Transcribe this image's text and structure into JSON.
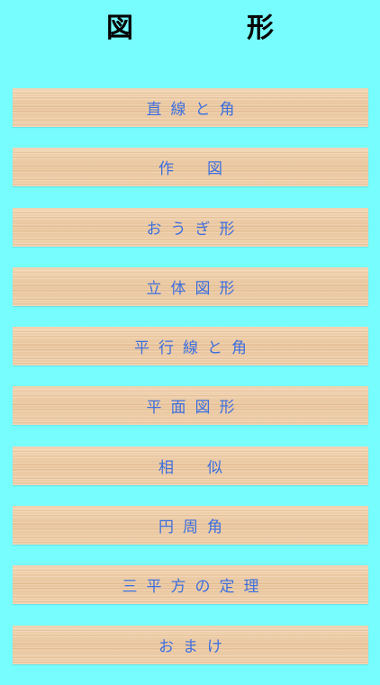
{
  "header": {
    "title": "図　形"
  },
  "menu": {
    "items": [
      {
        "label": "直線と角"
      },
      {
        "label": "作　図"
      },
      {
        "label": "おうぎ形"
      },
      {
        "label": "立体図形"
      },
      {
        "label": "平行線と角"
      },
      {
        "label": "平面図形"
      },
      {
        "label": "相　似"
      },
      {
        "label": "円周角"
      },
      {
        "label": "三平方の定理"
      },
      {
        "label": "おまけ"
      }
    ]
  },
  "colors": {
    "background": "#78fdfe",
    "button_wood": "#edcba5",
    "label_text": "#3f6fdc",
    "title_text": "#000000"
  }
}
